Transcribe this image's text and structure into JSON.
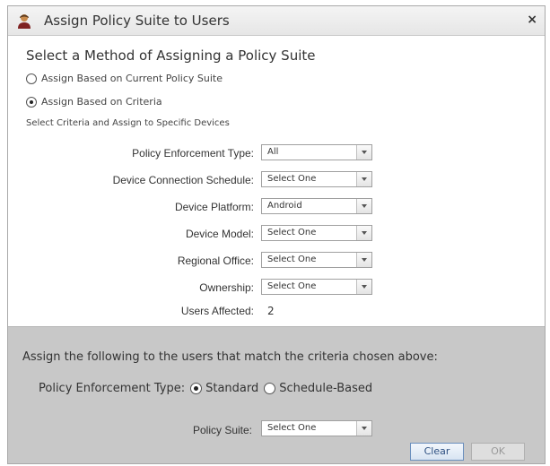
{
  "dialog": {
    "title": "Assign Policy Suite to Users",
    "close": "×"
  },
  "method": {
    "heading": "Select a Method of Assigning a Policy Suite",
    "options": [
      {
        "label": "Assign Based on Current Policy Suite",
        "selected": false
      },
      {
        "label": "Assign Based on Criteria",
        "selected": true
      }
    ],
    "hint": "Select Criteria and Assign to Specific Devices"
  },
  "criteria": [
    {
      "label": "Policy Enforcement Type:",
      "value": "All"
    },
    {
      "label": "Device Connection Schedule:",
      "value": "Select One"
    },
    {
      "label": "Device Platform:",
      "value": "Android"
    },
    {
      "label": "Device Model:",
      "value": "Select One"
    },
    {
      "label": "Regional Office:",
      "value": "Select One"
    },
    {
      "label": "Ownership:",
      "value": "Select One"
    }
  ],
  "users_affected": {
    "label": "Users Affected:",
    "value": "2"
  },
  "assign": {
    "text": "Assign the following to the users that match the criteria chosen above:",
    "pet_label": "Policy Enforcement Type:",
    "pet_options": [
      {
        "label": "Standard",
        "selected": true
      },
      {
        "label": "Schedule-Based",
        "selected": false
      }
    ],
    "policy_suite_label": "Policy Suite:",
    "policy_suite_value": "Select One"
  },
  "buttons": {
    "clear": "Clear",
    "ok": "OK"
  },
  "colors": {
    "panel": "#c8c8c8",
    "primary_button_border": "#6a8fbd"
  }
}
